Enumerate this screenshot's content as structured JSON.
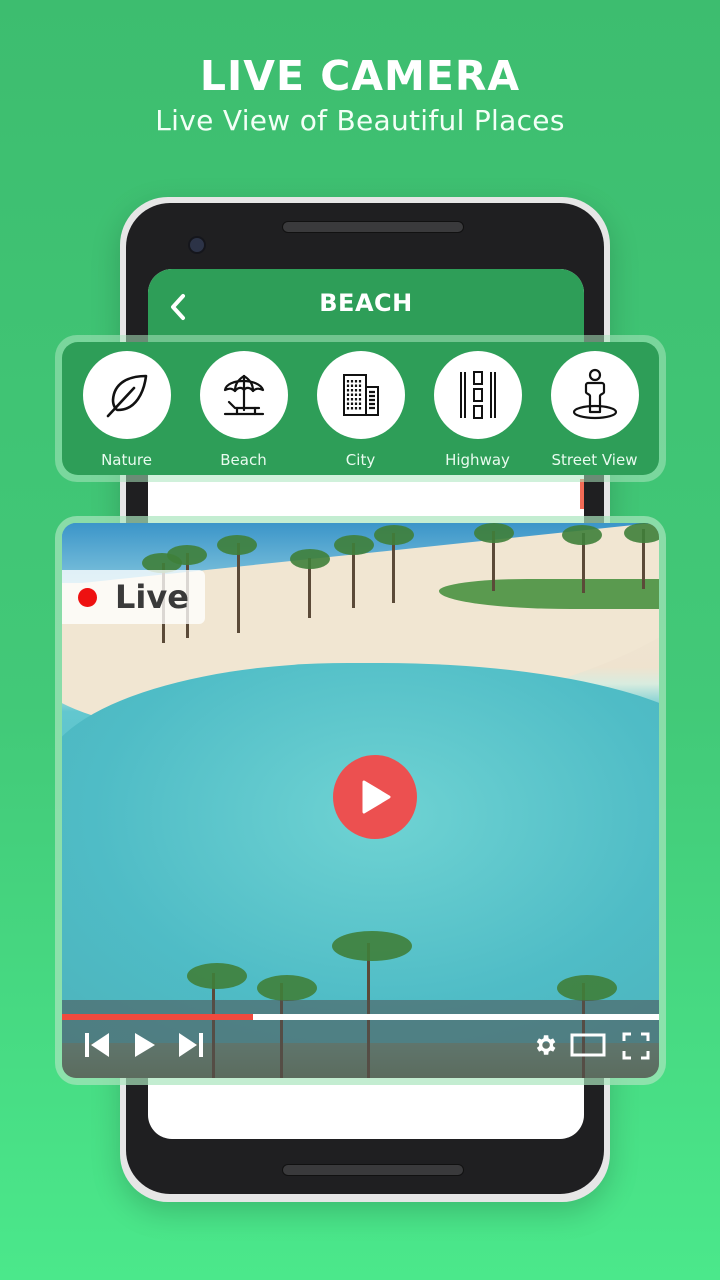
{
  "promo": {
    "title": "LIVE CAMERA",
    "subtitle": "Live View of Beautiful Places"
  },
  "app_bar": {
    "title": "BEACH",
    "back_icon": "chevron-left-icon"
  },
  "categories": [
    {
      "label": "Nature",
      "icon": "leaf-icon"
    },
    {
      "label": "Beach",
      "icon": "beach-umbrella-icon"
    },
    {
      "label": "City",
      "icon": "buildings-icon"
    },
    {
      "label": "Highway",
      "icon": "road-icon"
    },
    {
      "label": "Street View",
      "icon": "street-view-person-icon"
    }
  ],
  "player": {
    "live_label": "Live",
    "progress_fraction": 0.32,
    "controls": [
      "skip-previous-icon",
      "play-icon",
      "skip-next-icon",
      "settings-icon",
      "theater-mode-icon",
      "fullscreen-icon"
    ]
  },
  "colors": {
    "brand_green": "#2e9e58",
    "live_red": "#ee1111",
    "play_red": "#ec5050",
    "progress_red": "#f04a3e"
  }
}
